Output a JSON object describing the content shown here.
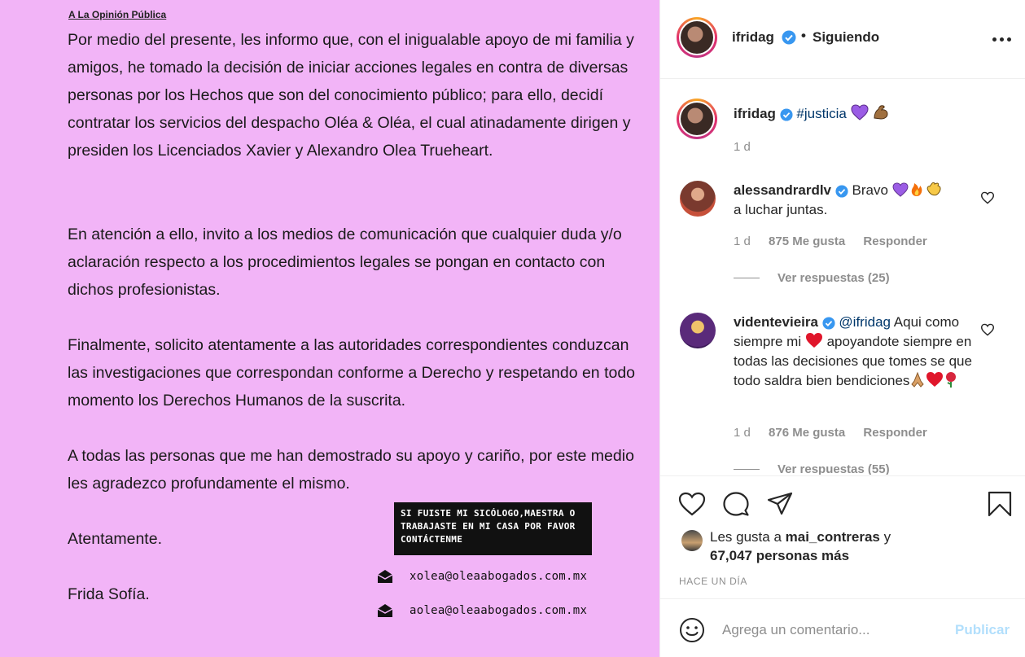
{
  "letter": {
    "title": "A La Opinión Pública",
    "paragraph1": "Por medio del presente, les informo que, con el inigualable apoyo de mi familia y amigos, he tomado la decisión de iniciar acciones legales en contra de diversas personas por los Hechos que son del conocimiento público; para ello, decidí contratar los servicios del despacho Oléa & Oléa, el cual atinadamente dirigen y presiden los Licenciados Xavier y Alexandro Olea Trueheart.",
    "paragraph2": "En atención a ello, invito a los medios de comunicación que cualquier duda y/o aclaración respecto a los procedimientos legales se pongan en contacto con dichos profesionistas.",
    "paragraph3": "Finalmente, solicito atentamente a las autoridades correspondientes conduzcan las investigaciones que correspondan conforme a Derecho y respetando en todo momento los Derechos Humanos de la suscrita.",
    "paragraph4": "A todas las personas que me han demostrado su apoyo y cariño, por este medio les agradezco profundamente el mismo.",
    "closing": "Atentamente.",
    "signature": "Frida Sofía.",
    "sticker": "SI FUISTE MI SICÓLOGO,MAESTRA O TRABAJASTE EN MI CASA POR FAVOR CONTÁCTENME",
    "email1": "xolea@oleaabogados.com.mx",
    "email2": "aolea@oleaabogados.com.mx",
    "background_color": "#f2b4f7"
  },
  "header": {
    "username": "ifridag",
    "separator": "•",
    "follow_status": "Siguiendo"
  },
  "caption": {
    "username": "ifridag",
    "hashtag": "#justicia",
    "emojis": [
      "purple-heart",
      "flexed-biceps"
    ],
    "time": "1 d"
  },
  "comments": [
    {
      "username": "alessandrardlv",
      "text_before": "Bravo",
      "emojis": [
        "purple-heart",
        "fire",
        "clapping-hands"
      ],
      "text_after": "a luchar juntas.",
      "time": "1 d",
      "likes": "875 Me gusta",
      "reply_label": "Responder",
      "view_replies": "Ver respuestas (25)"
    },
    {
      "username": "videntevieira",
      "mention": "@ifridag",
      "text1": "Aqui como siempre mi",
      "text2": "apoyandote siempre en todas las decisiones que tomes se que todo saldra bien bendiciones",
      "emojis": [
        "red-heart",
        "folded-hands",
        "red-heart",
        "rose"
      ],
      "time": "1 d",
      "likes": "876 Me gusta",
      "reply_label": "Responder",
      "view_replies": "Ver respuestas (55)"
    }
  ],
  "likes": {
    "prefix": "Les gusta a",
    "liker": "mai_contreras",
    "conjunction": "y",
    "others": "67,047 personas más"
  },
  "post_time": "HACE UN DÍA",
  "comment_box": {
    "placeholder": "Agrega un comentario...",
    "publish_label": "Publicar"
  },
  "colors": {
    "verified": "#3897f0",
    "link": "#00376b",
    "muted": "#8e8e8e",
    "publish_disabled": "#b2dffc"
  }
}
